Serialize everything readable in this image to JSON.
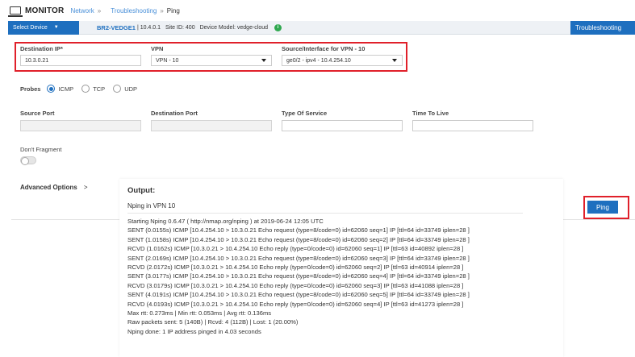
{
  "header": {
    "title": "MONITOR",
    "breadcrumb": [
      "Network",
      "Troubleshooting",
      "Ping"
    ]
  },
  "device_bar": {
    "select_label": "Select Device",
    "device_name": "BR2-VEDGE1",
    "device_ip": "| 10.4.0.1",
    "site_id": "Site ID: 400",
    "device_model": "Device Model: vedge-cloud",
    "troubleshooting_label": "Troubleshooting"
  },
  "form": {
    "destination_ip_label": "Destination IP*",
    "destination_ip_value": "10.3.0.21",
    "vpn_label": "VPN",
    "vpn_value": "VPN - 10",
    "source_interface_label": "Source/Interface for VPN - 10",
    "source_interface_value": "ge0/2 - ipv4 - 10.4.254.10",
    "probes_label": "Probes",
    "probe_options": [
      "ICMP",
      "TCP",
      "UDP"
    ],
    "probe_selected": "ICMP",
    "source_port_label": "Source Port",
    "destination_port_label": "Destination Port",
    "type_of_service_label": "Type Of Service",
    "time_to_live_label": "Time To Live",
    "dont_fragment_label": "Don't Fragment",
    "advanced_options_label": "Advanced Options",
    "ping_button_label": "Ping"
  },
  "output": {
    "title": "Output:",
    "subtitle": "Nping in VPN 10",
    "lines": [
      "Starting Nping 0.6.47 ( http://nmap.org/nping ) at 2019-06-24 12:05 UTC",
      "SENT (0.0155s) ICMP [10.4.254.10 > 10.3.0.21 Echo request (type=8/code=0) id=62060 seq=1] IP [ttl=64 id=33749 iplen=28 ]",
      "SENT (1.0158s) ICMP [10.4.254.10 > 10.3.0.21 Echo request (type=8/code=0) id=62060 seq=2] IP [ttl=64 id=33749 iplen=28 ]",
      "RCVD (1.0162s) ICMP [10.3.0.21 > 10.4.254.10 Echo reply (type=0/code=0) id=62060 seq=1] IP [ttl=63 id=40892 iplen=28 ]",
      "SENT (2.0169s) ICMP [10.4.254.10 > 10.3.0.21 Echo request (type=8/code=0) id=62060 seq=3] IP [ttl=64 id=33749 iplen=28 ]",
      "RCVD (2.0172s) ICMP [10.3.0.21 > 10.4.254.10 Echo reply (type=0/code=0) id=62060 seq=2] IP [ttl=63 id=40914 iplen=28 ]",
      "SENT (3.0177s) ICMP [10.4.254.10 > 10.3.0.21 Echo request (type=8/code=0) id=62060 seq=4] IP [ttl=64 id=33749 iplen=28 ]",
      "RCVD (3.0179s) ICMP [10.3.0.21 > 10.4.254.10 Echo reply (type=0/code=0) id=62060 seq=3] IP [ttl=63 id=41088 iplen=28 ]",
      "SENT (4.0191s) ICMP [10.4.254.10 > 10.3.0.21 Echo request (type=8/code=0) id=62060 seq=5] IP [ttl=64 id=33749 iplen=28 ]",
      "RCVD (4.0193s) ICMP [10.3.0.21 > 10.4.254.10 Echo reply (type=0/code=0) id=62060 seq=4] IP [ttl=63 id=41273 iplen=28 ]",
      "Max rtt: 0.273ms | Min rtt: 0.053ms | Avg rtt: 0.136ms",
      "Raw packets sent: 5 (140B) | Rcvd: 4 (112B) | Lost: 1 (20.00%)",
      "Nping done: 1 IP address pinged in 4.03 seconds"
    ]
  },
  "colors": {
    "accent": "#1e6fbf",
    "highlight_box": "#e0202a",
    "info_icon": "#2fa84f"
  }
}
